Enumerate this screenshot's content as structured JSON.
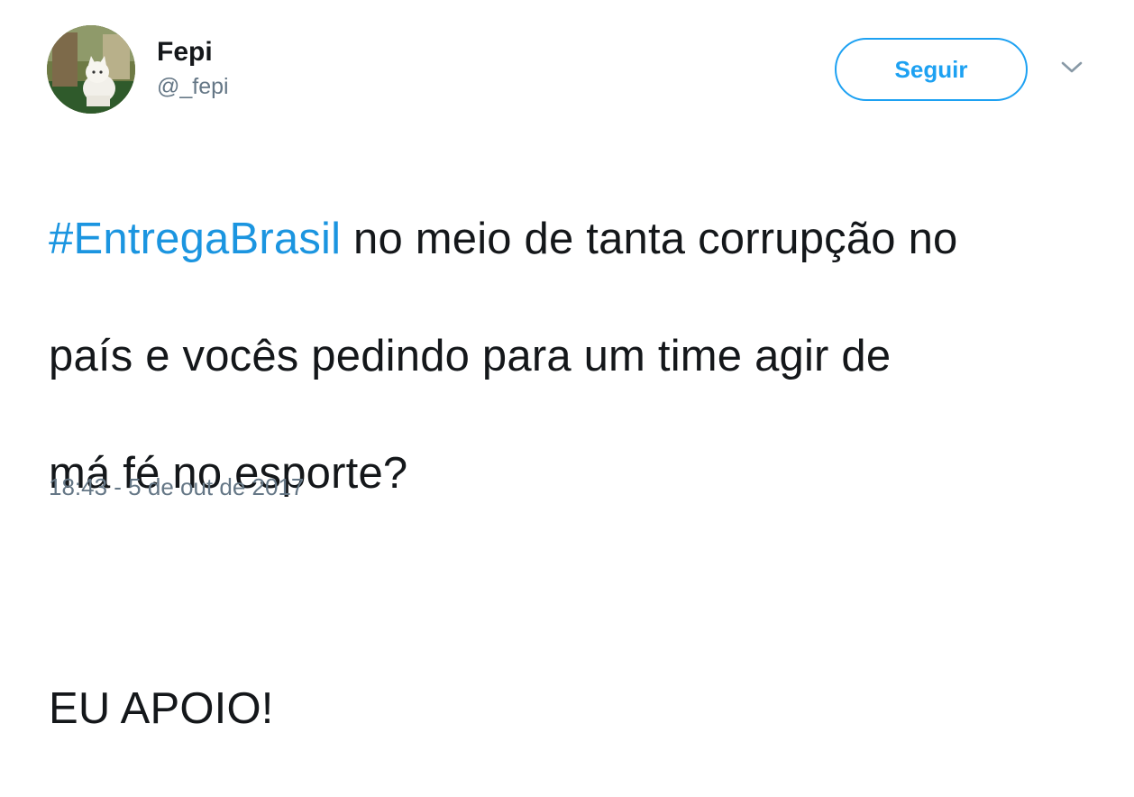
{
  "author": {
    "display_name": "Fepi",
    "handle": "@_fepi",
    "avatar_icon": "cat-photo-avatar"
  },
  "actions": {
    "follow_label": "Seguir",
    "more_icon": "chevron-down-icon"
  },
  "tweet": {
    "hashtag": "#EntregaBrasil",
    "line1_rest": " no meio de tanta corrupção no",
    "line2": "país e vocês pedindo para um time agir de",
    "line3": "má fé no esporte?",
    "line4": "EU APOIO!"
  },
  "meta": {
    "timestamp": "18:43 - 5 de out de 2017"
  },
  "colors": {
    "accent": "#1da1f2",
    "hashtag": "#1b95e0",
    "text": "#14171a",
    "secondary": "#657786"
  }
}
